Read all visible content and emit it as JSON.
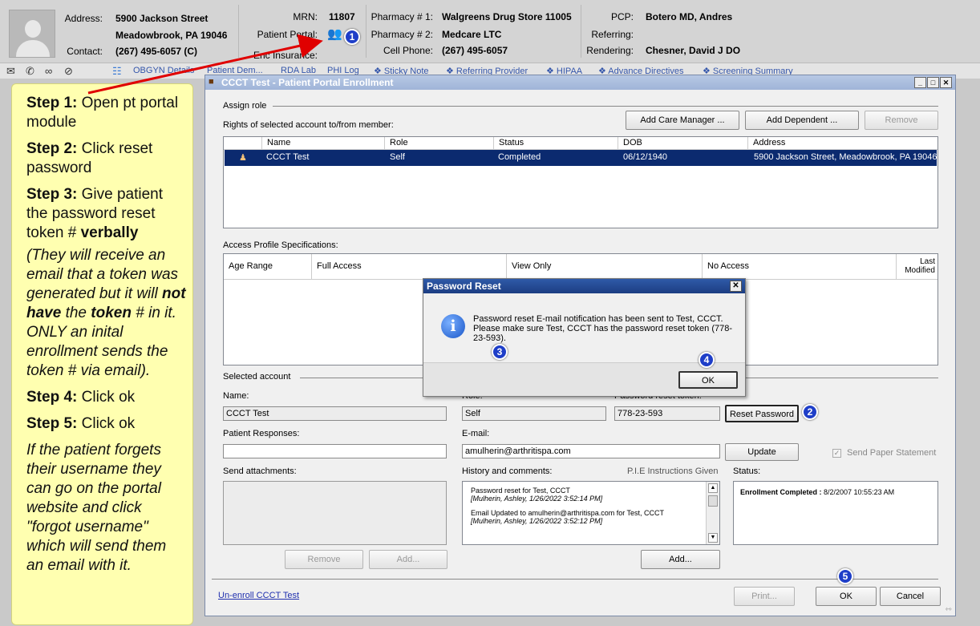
{
  "header": {
    "address_label": "Address:",
    "address_line1": "5900 Jackson Street",
    "address_line2": "Meadowbrook, PA 19046",
    "contact_label": "Contact:",
    "contact_value": "(267) 495-6057 (C)",
    "mrn_label": "MRN:",
    "mrn_value": "11807",
    "portal_label": "Patient Portal:",
    "enc_insurance_label": "Enc Insurance:",
    "pharmacy1_label": "Pharmacy # 1:",
    "pharmacy1_value": "Walgreens Drug Store 11005",
    "pharmacy2_label": "Pharmacy # 2:",
    "pharmacy2_value": "Medcare LTC",
    "cell_label": "Cell Phone:",
    "cell_value": "(267) 495-6057",
    "pcp_label": "PCP:",
    "pcp_value": "Botero MD, Andres",
    "referring_label": "Referring:",
    "rendering_label": "Rendering:",
    "rendering_value": "Chesner, David J DO"
  },
  "toolbar": {
    "links": [
      "OBGYN Details",
      "Patient Dem...",
      "RDA Lab",
      "PHI Log",
      "❖ Sticky Note",
      "❖ Referring Provider",
      "❖ HIPAA",
      "❖ Advance Directives",
      "❖ Screening Summary"
    ]
  },
  "instructions": {
    "step1_label": "Step 1:",
    "step1_text": " Open pt portal module",
    "step2_label": "Step 2:",
    "step2_text": " Click reset password",
    "step3_label": "Step 3:",
    "step3_text": " Give patient the password reset token # ",
    "step3_bold": "verbally",
    "note_a": "(They will receive an email that a token was generated but it will ",
    "note_b": "not have",
    "note_c": " the ",
    "note_d": "token",
    "note_e": " # in it. ONLY an inital enrollment sends the token # via email).",
    "step4_label": "Step 4:",
    "step4_text": " Click ok",
    "step5_label": "Step 5:",
    "step5_text": " Click ok",
    "footer_note": "If the patient forgets their username they can go on the portal website and click \"forgot username\" which will send them an email with it."
  },
  "window": {
    "title": "CCCT Test - Patient Portal Enrollment",
    "assign_role_label": "Assign role",
    "rights_label": "Rights of selected account to/from member:",
    "add_care_manager": "Add Care Manager ...",
    "add_dependent": "Add Dependent ...",
    "remove": "Remove",
    "members_columns": [
      "Name",
      "Role",
      "Status",
      "DOB",
      "Address"
    ],
    "members_row": [
      "CCCT Test",
      "Self",
      "Completed",
      "06/12/1940",
      "5900 Jackson Street, Meadowbrook, PA 19046"
    ],
    "access_label": "Access Profile Specifications:",
    "access_columns": [
      "Age Range",
      "Full Access",
      "View Only",
      "No Access",
      "Last Modified"
    ],
    "selected_account_label": "Selected account",
    "name_label": "Name:",
    "name_value": "CCCT Test",
    "role_label": "Role:",
    "role_value": "Self",
    "token_label": "Password reset token:",
    "token_value": "778-23-593",
    "reset_password": "Reset Password",
    "responses_label": "Patient Responses:",
    "email_label": "E-mail:",
    "email_value": "amulherin@arthritispa.com",
    "update": "Update",
    "send_paper": "Send Paper Statement",
    "attachments_label": "Send attachments:",
    "history_label": "History and comments:",
    "pie_label": "P.I.E Instructions Given",
    "status_label": "Status:",
    "history_entries": [
      {
        "text": "Password reset for Test, CCCT",
        "meta": "[Mulherin, Ashley, 1/26/2022 3:52:14 PM]"
      },
      {
        "text": "Email Updated to amulherin@arthritispa.com for Test, CCCT",
        "meta": "[Mulherin, Ashley, 1/26/2022 3:52:12 PM]"
      }
    ],
    "status_bold": "Enrollment Completed :",
    "status_value": " 8/2/2007 10:55:23 AM",
    "remove2": "Remove",
    "add_attach": "Add...",
    "add_history": "Add...",
    "unenroll": "Un-enroll CCCT Test",
    "print": "Print...",
    "ok": "OK",
    "cancel": "Cancel"
  },
  "dialog": {
    "title": "Password Reset",
    "message": "Password reset E-mail notification has been sent to Test, CCCT. Please make sure Test, CCCT has the password reset token (778-23-593).",
    "ok": "OK"
  },
  "badges": [
    "1",
    "2",
    "3",
    "4",
    "5"
  ],
  "colors": {
    "badge": "#1e3ec8",
    "arrow": "#e00000",
    "selection": "#0b2a6f",
    "note_bg": "#ffffb0"
  }
}
